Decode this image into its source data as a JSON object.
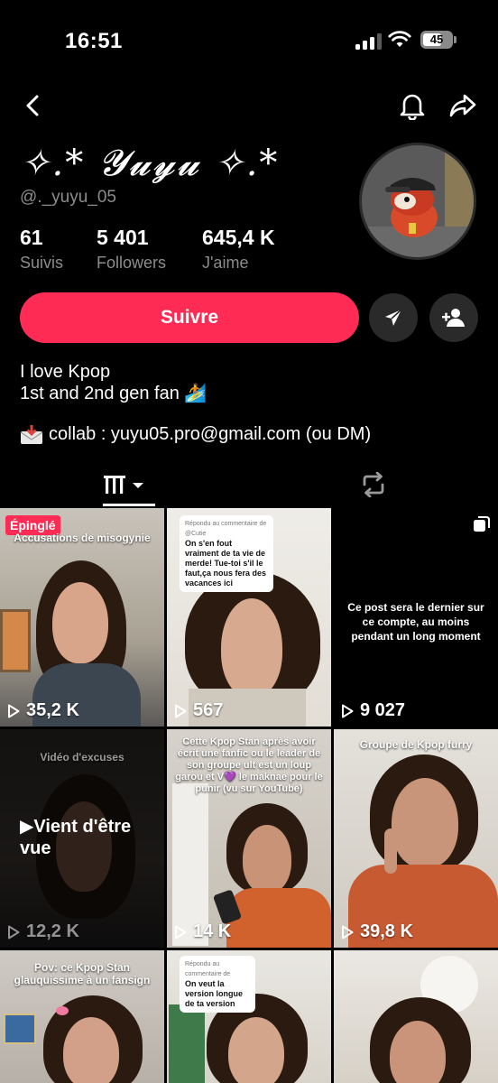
{
  "status_bar": {
    "time": "16:51",
    "battery": "45"
  },
  "profile": {
    "display_name": "✧.* 𝓨𝓾𝔂𝓾 ✧.*",
    "username": "@._yuyu_05",
    "stats": [
      {
        "value": "61",
        "label": "Suivis"
      },
      {
        "value": "5 401",
        "label": "Followers"
      },
      {
        "value": "645,4 K",
        "label": "J'aime"
      }
    ],
    "follow_label": "Suivre",
    "bio_line1": "I love Kpop",
    "bio_line2": "1st and 2nd gen fan 🏄",
    "contact": "collab : yuyu05.pro@gmail.com (ou DM)"
  },
  "colors": {
    "accent": "#fe2c55",
    "muted": "#8c8c8c",
    "button_dark": "#2a2a2a"
  },
  "tabs": [
    {
      "icon": "grid-icon",
      "active": true
    },
    {
      "icon": "repost-icon",
      "active": false
    }
  ],
  "videos": [
    {
      "views": "35,2 K",
      "caption": "Accusations de misogynie",
      "pinned": "Épinglé"
    },
    {
      "views": "567",
      "reply_meta": "Répondu au commentaire de @Cutie",
      "reply_text": "On s'en fout vraiment de ta vie de merde! Tue-toi s'il le faut,ça nous fera des vacances ici"
    },
    {
      "views": "9 027",
      "caption": "Ce post sera le dernier sur ce compte, au moins pendant un long moment"
    },
    {
      "views": "12,2 K",
      "caption": "Vidéo d'excuses",
      "watched": "Vient d'être vue"
    },
    {
      "views": "14 K",
      "caption": "Cette Kpop Stan après avoir écrit une fanfic ou le leader de son groupe ult est un loup garou et V💜 le maknae pour le punir (vu sur YouTube)"
    },
    {
      "views": "39,8 K",
      "caption": "Groupe de Kpop furry"
    },
    {
      "caption": "Pov: ce Kpop Stan glauquissime à un fansign"
    },
    {
      "reply_meta": "Répondu au commentaire de",
      "reply_text": "On veut la version longue de ta version"
    },
    {}
  ]
}
